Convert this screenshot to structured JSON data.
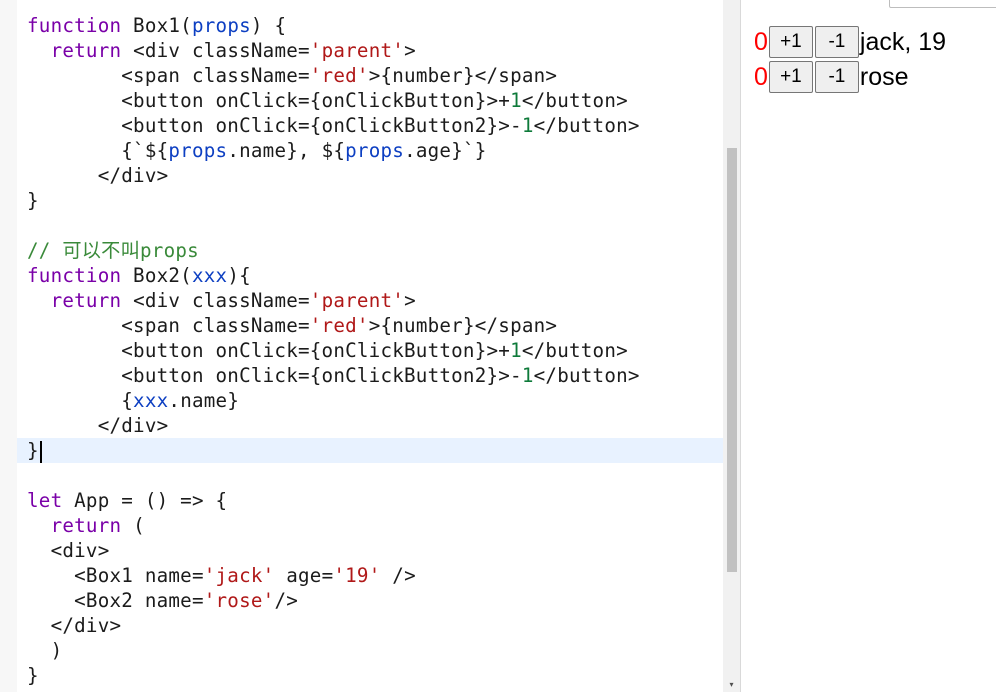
{
  "editor": {
    "lines": [
      [
        {
          "t": "kw",
          "s": "function"
        },
        {
          "t": "plain",
          "s": " Box1("
        },
        {
          "t": "var",
          "s": "props"
        },
        {
          "t": "plain",
          "s": ") {"
        }
      ],
      [
        {
          "t": "plain",
          "s": "  "
        },
        {
          "t": "kw",
          "s": "return"
        },
        {
          "t": "plain",
          "s": " <div className="
        },
        {
          "t": "str",
          "s": "'parent'"
        },
        {
          "t": "plain",
          "s": ">"
        }
      ],
      [
        {
          "t": "plain",
          "s": "        <span className="
        },
        {
          "t": "str",
          "s": "'red'"
        },
        {
          "t": "plain",
          "s": ">{number}</span>"
        }
      ],
      [
        {
          "t": "plain",
          "s": "        <button onClick={onClickButton}>+"
        },
        {
          "t": "num",
          "s": "1"
        },
        {
          "t": "plain",
          "s": "</button>"
        }
      ],
      [
        {
          "t": "plain",
          "s": "        <button onClick={onClickButton2}>-"
        },
        {
          "t": "num",
          "s": "1"
        },
        {
          "t": "plain",
          "s": "</button>"
        }
      ],
      [
        {
          "t": "plain",
          "s": "        {`${"
        },
        {
          "t": "var",
          "s": "props"
        },
        {
          "t": "plain",
          "s": ".name}, ${"
        },
        {
          "t": "var",
          "s": "props"
        },
        {
          "t": "plain",
          "s": ".age}`}"
        }
      ],
      [
        {
          "t": "plain",
          "s": "      </div>"
        }
      ],
      [
        {
          "t": "plain",
          "s": "}"
        }
      ],
      [
        {
          "t": "plain",
          "s": ""
        }
      ],
      [
        {
          "t": "cm",
          "s": "// 可以不叫props"
        }
      ],
      [
        {
          "t": "kw",
          "s": "function"
        },
        {
          "t": "plain",
          "s": " Box2("
        },
        {
          "t": "var",
          "s": "xxx"
        },
        {
          "t": "plain",
          "s": "){"
        }
      ],
      [
        {
          "t": "plain",
          "s": "  "
        },
        {
          "t": "kw",
          "s": "return"
        },
        {
          "t": "plain",
          "s": " <div className="
        },
        {
          "t": "str",
          "s": "'parent'"
        },
        {
          "t": "plain",
          "s": ">"
        }
      ],
      [
        {
          "t": "plain",
          "s": "        <span className="
        },
        {
          "t": "str",
          "s": "'red'"
        },
        {
          "t": "plain",
          "s": ">{number}</span>"
        }
      ],
      [
        {
          "t": "plain",
          "s": "        <button onClick={onClickButton}>+"
        },
        {
          "t": "num",
          "s": "1"
        },
        {
          "t": "plain",
          "s": "</button>"
        }
      ],
      [
        {
          "t": "plain",
          "s": "        <button onClick={onClickButton2}>-"
        },
        {
          "t": "num",
          "s": "1"
        },
        {
          "t": "plain",
          "s": "</button>"
        }
      ],
      [
        {
          "t": "plain",
          "s": "        {"
        },
        {
          "t": "var",
          "s": "xxx"
        },
        {
          "t": "plain",
          "s": ".name}"
        }
      ],
      [
        {
          "t": "plain",
          "s": "      </div>"
        }
      ],
      [
        {
          "t": "plain",
          "s": "}"
        }
      ],
      [
        {
          "t": "plain",
          "s": ""
        }
      ],
      [
        {
          "t": "kw",
          "s": "let"
        },
        {
          "t": "plain",
          "s": " App = () => {"
        }
      ],
      [
        {
          "t": "plain",
          "s": "  "
        },
        {
          "t": "kw",
          "s": "return"
        },
        {
          "t": "plain",
          "s": " ("
        }
      ],
      [
        {
          "t": "plain",
          "s": "  <div>"
        }
      ],
      [
        {
          "t": "plain",
          "s": "    <Box1 name="
        },
        {
          "t": "str",
          "s": "'jack'"
        },
        {
          "t": "plain",
          "s": " age="
        },
        {
          "t": "str",
          "s": "'19'"
        },
        {
          "t": "plain",
          "s": " />"
        }
      ],
      [
        {
          "t": "plain",
          "s": "    <Box2 name="
        },
        {
          "t": "str",
          "s": "'rose'"
        },
        {
          "t": "plain",
          "s": "/>"
        }
      ],
      [
        {
          "t": "plain",
          "s": "  </div>"
        }
      ],
      [
        {
          "t": "plain",
          "s": "  )"
        }
      ],
      [
        {
          "t": "plain",
          "s": "}"
        }
      ]
    ],
    "active_line_index": 17,
    "scroll_down_glyph": "▾"
  },
  "preview": {
    "boxes": [
      {
        "number": "0",
        "plus_label": "+1",
        "minus_label": "-1",
        "text": "jack, 19"
      },
      {
        "number": "0",
        "plus_label": "+1",
        "minus_label": "-1",
        "text": "rose"
      }
    ]
  },
  "colors": {
    "keyword": "#7a00a8",
    "variable": "#0d3fc2",
    "string": "#b01818",
    "number": "#0e7a3a",
    "comment": "#3a8a3a",
    "active_line": "#e8f2ff",
    "counter_red": "#ff0000"
  }
}
